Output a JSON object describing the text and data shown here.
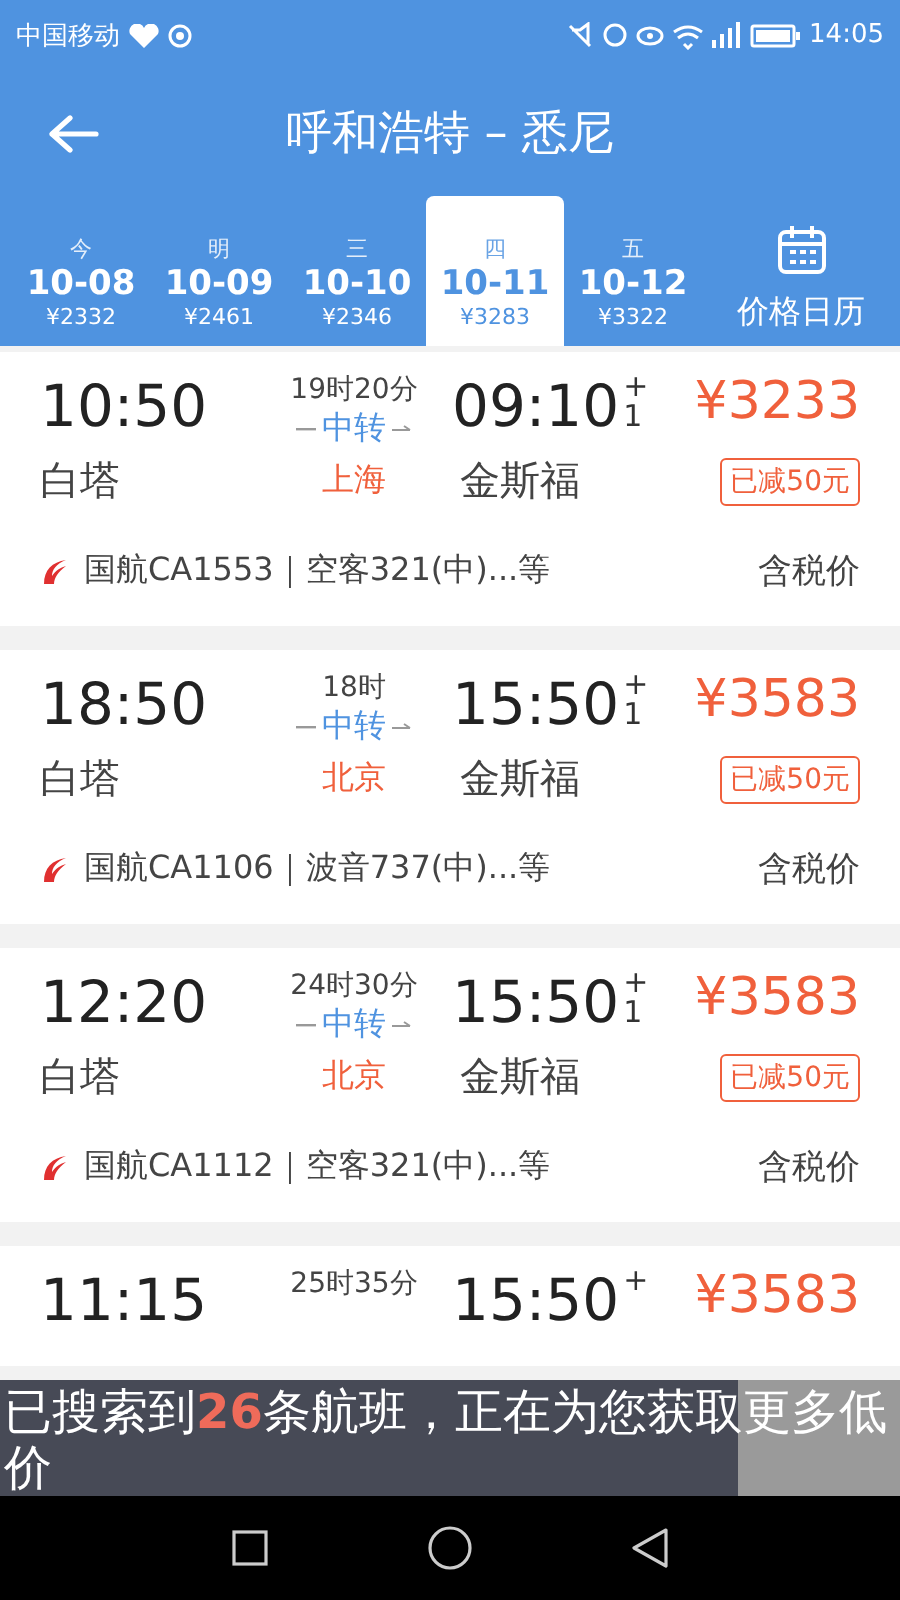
{
  "status_bar": {
    "carrier": "中国移动",
    "time": "14:05"
  },
  "header": {
    "title": "呼和浩特 – 悉尼"
  },
  "date_tabs": [
    {
      "weekday": "今",
      "date": "10-08",
      "price": "¥2332",
      "selected": false
    },
    {
      "weekday": "明",
      "date": "10-09",
      "price": "¥2461",
      "selected": false
    },
    {
      "weekday": "三",
      "date": "10-10",
      "price": "¥2346",
      "selected": false
    },
    {
      "weekday": "四",
      "date": "10-11",
      "price": "¥3283",
      "selected": true
    },
    {
      "weekday": "五",
      "date": "10-12",
      "price": "¥3322",
      "selected": false
    }
  ],
  "calendar_button": {
    "label": "价格日历"
  },
  "flights": [
    {
      "depart_time": "10:50",
      "duration": "19时20分",
      "transfer": "中转",
      "arrive_time": "09:10",
      "day_mark": "+",
      "day_count": "1",
      "price": "¥3233",
      "discount": "已减50元",
      "depart_airport": "白塔",
      "transfer_city": "上海",
      "arrive_airport": "金斯福",
      "flight_info": "国航CA1553｜空客321(中)...等",
      "tax_note": "含税价"
    },
    {
      "depart_time": "18:50",
      "duration": "18时",
      "transfer": "中转",
      "arrive_time": "15:50",
      "day_mark": "+",
      "day_count": "1",
      "price": "¥3583",
      "discount": "已减50元",
      "depart_airport": "白塔",
      "transfer_city": "北京",
      "arrive_airport": "金斯福",
      "flight_info": "国航CA1106｜波音737(中)...等",
      "tax_note": "含税价"
    },
    {
      "depart_time": "12:20",
      "duration": "24时30分",
      "transfer": "中转",
      "arrive_time": "15:50",
      "day_mark": "+",
      "day_count": "1",
      "price": "¥3583",
      "discount": "已减50元",
      "depart_airport": "白塔",
      "transfer_city": "北京",
      "arrive_airport": "金斯福",
      "flight_info": "国航CA1112｜空客321(中)...等",
      "tax_note": "含税价"
    },
    {
      "depart_time": "11:15",
      "duration": "25时35分",
      "arrive_time": "15:50",
      "day_mark": "+",
      "price": "¥3583"
    }
  ],
  "toast": {
    "text": "已搜索到**26**条航班，正在为您获取更多低价"
  }
}
